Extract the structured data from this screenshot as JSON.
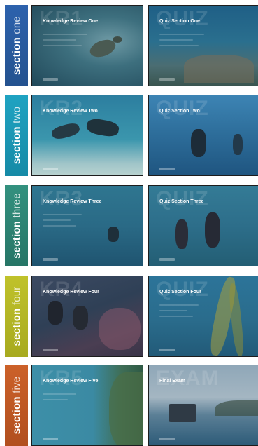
{
  "sections": [
    {
      "label_bold": "section",
      "label_light": "one",
      "color": "#2b5ea8",
      "kr": {
        "ghost": "KR1",
        "title": "Knowledge Review One",
        "image": "sea-turtle"
      },
      "quiz": {
        "ghost": "QUIZ",
        "title": "Quiz Section One",
        "image": "coral-reef"
      }
    },
    {
      "label_bold": "section",
      "label_light": "two",
      "color": "#1b9ab8",
      "kr": {
        "ghost": "KR2",
        "title": "Knowledge Review Two",
        "image": "divers-on-sand"
      },
      "quiz": {
        "ghost": "QUIZ",
        "title": "Quiz Section Two",
        "image": "diver-ascending"
      }
    },
    {
      "label_bold": "section",
      "label_light": "three",
      "color": "#2f8a7a",
      "kr": {
        "ghost": "KR3",
        "title": "Knowledge Review Three",
        "image": "diver-in-blue"
      },
      "quiz": {
        "ghost": "QUIZ",
        "title": "Quiz Section Three",
        "image": "two-divers"
      }
    },
    {
      "label_bold": "section",
      "label_light": "four",
      "color": "#b7ba27",
      "kr": {
        "ghost": "KR4",
        "title": "Knowledge Review Four",
        "image": "divers-by-reef"
      },
      "quiz": {
        "ghost": "QUIZ",
        "title": "Quiz Section Four",
        "image": "kelp-forest"
      }
    },
    {
      "label_bold": "section",
      "label_light": "five",
      "color": "#c45b26",
      "kr": {
        "ghost": "KR5",
        "title": "Knowledge Review Five",
        "image": "reef-wall"
      },
      "quiz": {
        "ghost": "EXAM",
        "title": "Final Exam",
        "image": "dive-boat"
      }
    }
  ]
}
